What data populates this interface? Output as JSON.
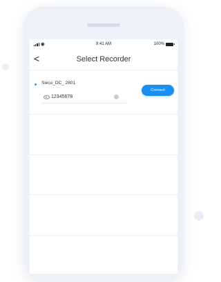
{
  "status_bar": {
    "time": "9:41 AM",
    "battery": "100%"
  },
  "nav": {
    "back_glyph": "<",
    "title": "Select Recorder"
  },
  "device": {
    "name": "Sieco_DC_ 2801",
    "password": "12345678",
    "connect_label": "Connect",
    "accent_color": "#1b8ff0"
  }
}
